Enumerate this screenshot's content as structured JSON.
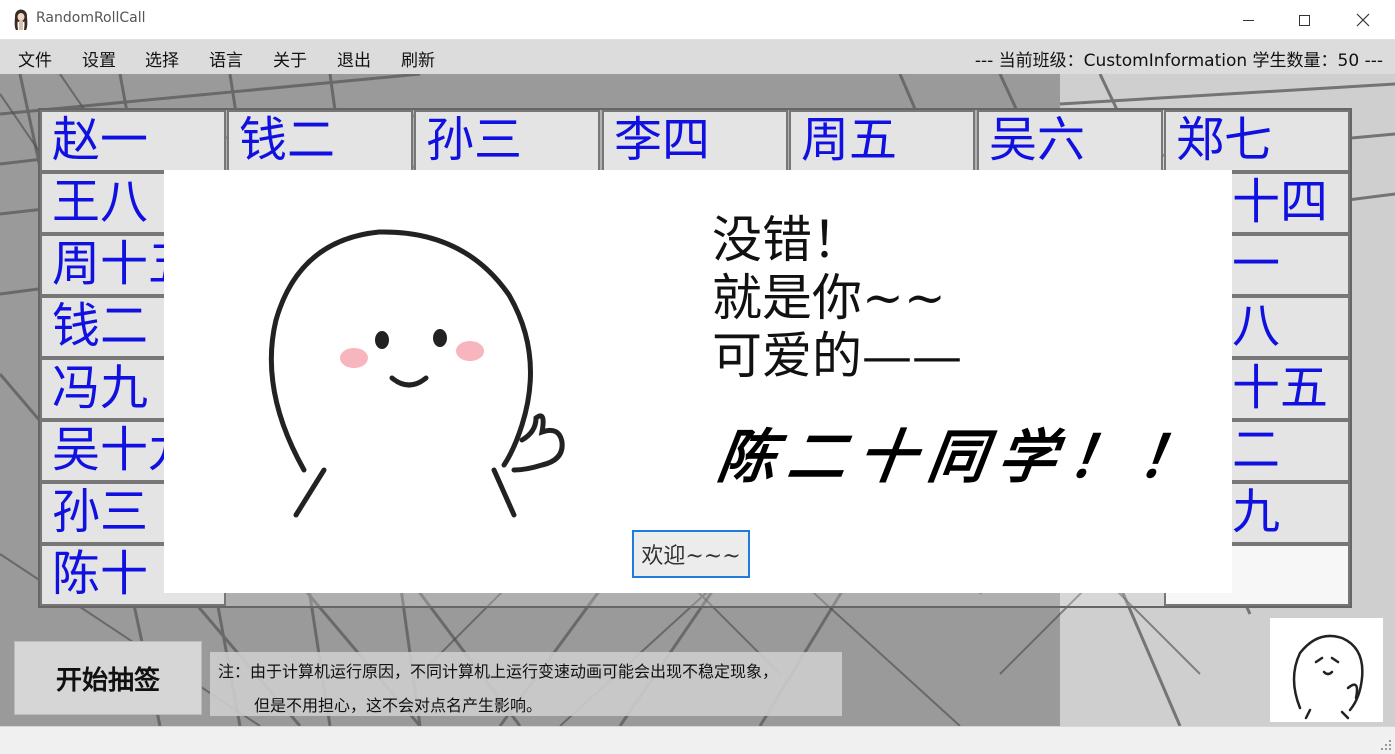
{
  "window": {
    "title": "RandomRollCall"
  },
  "menu": {
    "items": [
      "文件",
      "设置",
      "选择",
      "语言",
      "关于",
      "退出",
      "刷新"
    ]
  },
  "status": {
    "text": "---   当前班级：CustomInformation  学生数量：50  ---"
  },
  "grid": {
    "top_row": [
      "赵一",
      "钱二",
      "孙三",
      "李四",
      "周五",
      "吴六",
      "郑七"
    ],
    "left_col": [
      "王八",
      "周十五",
      "钱二",
      "冯九",
      "吴十九",
      "孙三",
      "陈十"
    ],
    "right_col": [
      "十四",
      "一",
      "八",
      "十五",
      "二",
      "九",
      ""
    ]
  },
  "popup": {
    "line1": "没错！",
    "line2": "就是你~~",
    "line3": "可爱的——",
    "name": "陈二十同学！！",
    "button": "欢迎~~~"
  },
  "controls": {
    "start_button": "开始抽签",
    "note_line1": "注：由于计算机运行原因，不同计算机上运行变速动画可能会出现不稳定现象，",
    "note_line2": "但是不用担心，这不会对点名产生影响。"
  },
  "colors": {
    "name_text": "#1010e0",
    "button_border": "#1e7be0"
  }
}
